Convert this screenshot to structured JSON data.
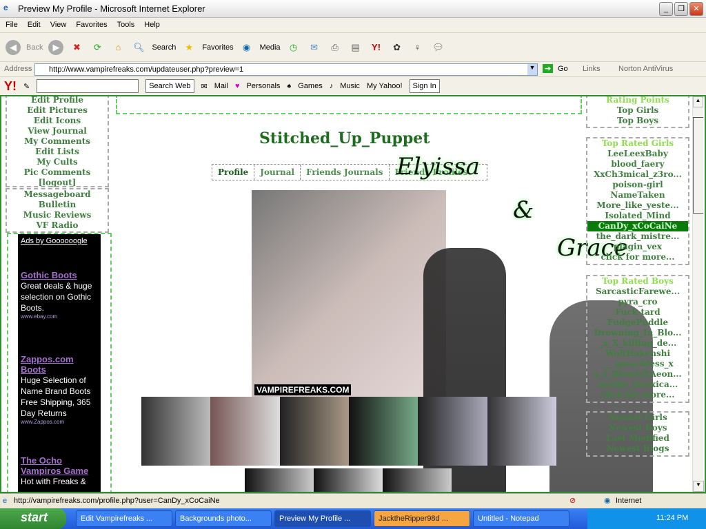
{
  "window": {
    "title": "Preview My Profile - Microsoft Internet Explorer"
  },
  "menu": [
    "File",
    "Edit",
    "View",
    "Favorites",
    "Tools",
    "Help"
  ],
  "toolbar": {
    "back": "Back",
    "search": "Search",
    "favorites": "Favorites",
    "media": "Media"
  },
  "address": {
    "label": "Address",
    "url": "http://www.vampirefreaks.com/updateuser.php?preview=1",
    "go": "Go",
    "links": "Links",
    "norton": "Norton AntiVirus"
  },
  "yahoo": {
    "search_btn": "Search Web",
    "mail": "Mail",
    "personals": "Personals",
    "games": "Games",
    "music": "Music",
    "my_yahoo": "My Yahoo!",
    "sign_in": "Sign In"
  },
  "left_nav": {
    "account": [
      "Edit Profile",
      "Edit Pictures",
      "Edit Icons",
      "View Journal",
      "My Comments",
      "Edit Lists",
      "My Cults",
      "Pic Comments",
      "[logout]"
    ],
    "community": [
      "Messageboard",
      "Bulletin",
      "Music Reviews",
      "VF Radio"
    ]
  },
  "ads": {
    "header": "Ads by Goooooogle",
    "items": [
      {
        "title": "Gothic Boots",
        "text": "Great deals & huge selection on Gothic Boots.",
        "url": "www.ebay.com"
      },
      {
        "title": "Zappos.com Boots",
        "text": "Huge Selection of Name Brand Boots Free Shipping, 365 Day Returns",
        "url": "www.Zappos.com"
      },
      {
        "title": "The Ocho Vampiros Game",
        "text": "Hot with Freaks &",
        "url": ""
      }
    ]
  },
  "profile": {
    "username": "Stitched_Up_Puppet",
    "tabs": [
      "Profile",
      "Journal",
      "Friends Journals",
      "Friends Profiles"
    ],
    "watermark": "VAMPIREFREAKS.COM",
    "overlay": [
      "Elyissa",
      "&",
      "Grace"
    ]
  },
  "right_nav": {
    "rating": {
      "title": "Rating Points",
      "items": [
        "Top Girls",
        "Top Boys"
      ]
    },
    "girls": {
      "title": "Top Rated Girls",
      "items": [
        "LeeLeexBaby",
        "blood_faery",
        "XxCh3mical_z3ro...",
        "poison-girl",
        "NameTaken",
        "More_like_yeste...",
        "Isolated_Mind",
        "CanDy_xCoCaiNe",
        "the_dark_mistre...",
        "plagin_vex",
        "click for more..."
      ]
    },
    "boys": {
      "title": "Top Rated Boys",
      "items": [
        "SarcasticFarewe...",
        "pyra_cro",
        "Fuck-tard",
        "FudgePuddle",
        "Drowning_In_Blo...",
        "_x_X_killing_de...",
        "WolfHakenshi",
        "___speachless_x",
        "x_x_BloodyXAeon...",
        "needle_intoxica...",
        "click for more..."
      ]
    },
    "newest": [
      "Newest Girls",
      "Newest Boys",
      "Last Modified",
      "Newest Blogs"
    ]
  },
  "status": {
    "url": "http://vampirefreaks.com/profile.php?user=CanDy_xCoCaiNe",
    "zone": "Internet"
  },
  "taskbar": {
    "start": "start",
    "tasks": [
      "Edit Vampirefreaks ...",
      "Backgrounds photo...",
      "Preview My Profile ...",
      "JacktheRipper98d ...",
      "Untitled - Notepad"
    ],
    "clock": "11:24 PM"
  }
}
